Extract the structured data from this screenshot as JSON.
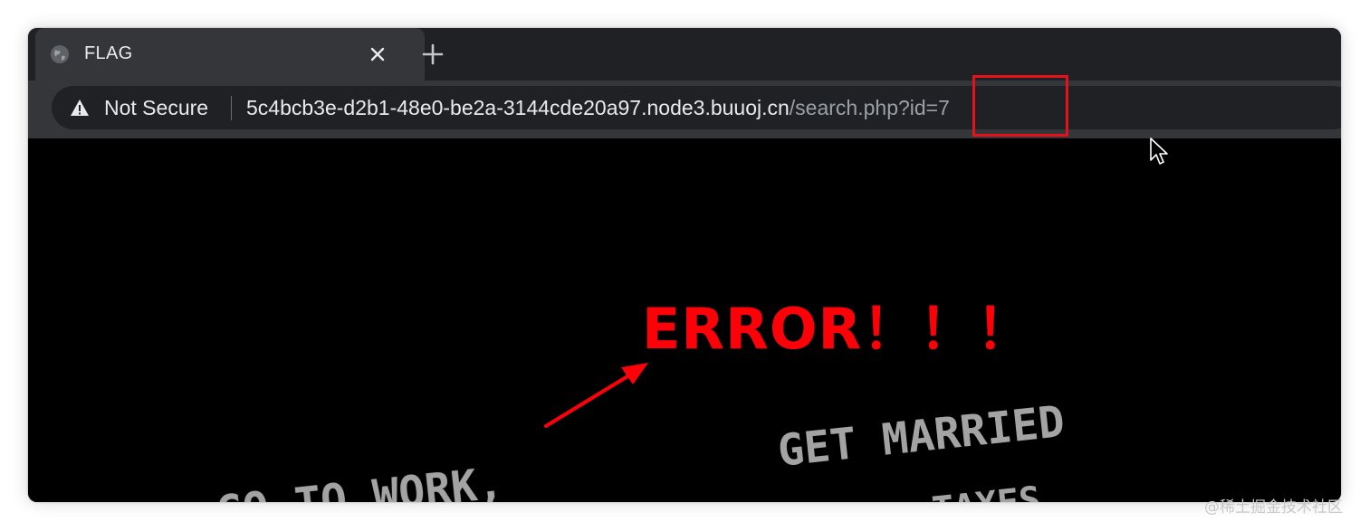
{
  "tab": {
    "title": "FLAG",
    "favicon": "globe-icon",
    "close_icon": "close-icon"
  },
  "new_tab_icon": "plus-icon",
  "omnibox": {
    "security_icon": "warning-triangle-icon",
    "security_label": "Not Secure",
    "url_host": "5c4bcb3e-d2b1-48e0-be2a-3144cde20a97.node3.buuoj.cn",
    "url_path": "/search.php?id=7"
  },
  "page": {
    "error_text": "ERROR！！！",
    "background_text_line1": "GET MARRIED",
    "background_text_line2": "GO TO WORK,",
    "background_text_line3": "TAXES"
  },
  "annotations": {
    "highlight_color": "#e5121b",
    "arrow_color": "#ff0008"
  },
  "watermark": "@稀土掘金技术社区",
  "colors": {
    "tabstrip": "#202124",
    "active_tab": "#35363a",
    "omnibox": "#202124",
    "page_bg": "#000000",
    "error_red": "#ff0008"
  }
}
